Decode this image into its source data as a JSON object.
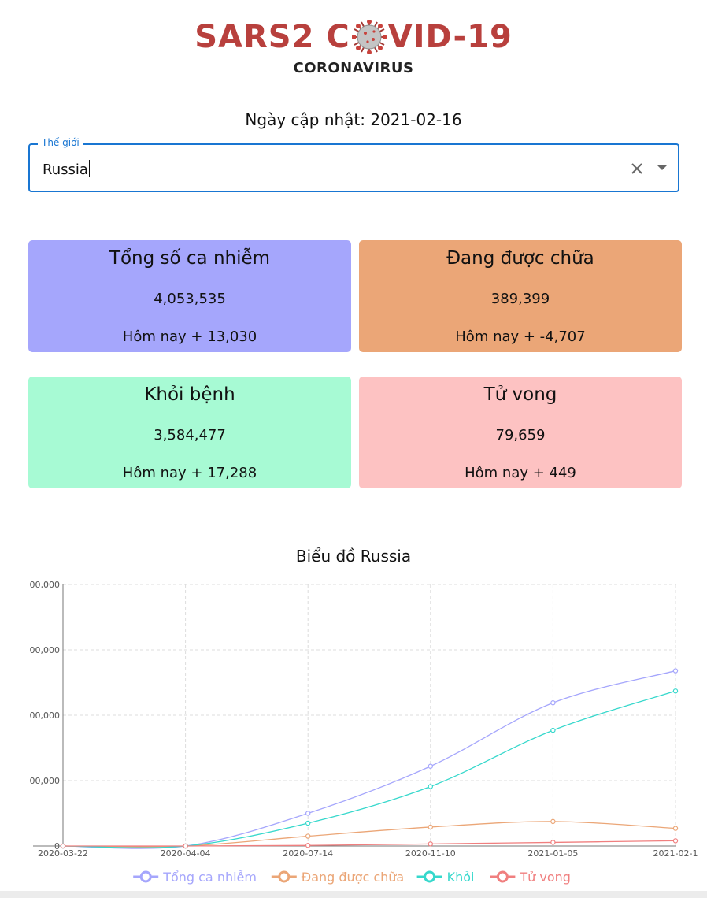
{
  "logo": {
    "title_left": "SARS2 C",
    "title_right": "VID-19",
    "subtitle": "CORONAVIRUS"
  },
  "update": {
    "label": "Ngày cập nhật: 2021-02-16"
  },
  "country_select": {
    "legend": "Thế giới",
    "value": "Russia"
  },
  "cards": {
    "total": {
      "title": "Tổng số ca nhiễm",
      "value": "4,053,535",
      "today": "Hôm nay + 13,030",
      "color": "#a5a6fc"
    },
    "active": {
      "title": "Đang được chữa",
      "value": "389,399",
      "today": "Hôm nay + -4,707",
      "color": "#eba677"
    },
    "recovered": {
      "title": "Khỏi bệnh",
      "value": "3,584,477",
      "today": "Hôm nay + 17,288",
      "color": "#a7fad4"
    },
    "deaths": {
      "title": "Tử vong",
      "value": "79,659",
      "today": "Hôm nay + 449",
      "color": "#fdc2c2"
    }
  },
  "chart_title": "Biểu đồ Russia",
  "chart_data": {
    "type": "line",
    "categories": [
      "2020-03-22",
      "2020-04-04",
      "2020-07-14",
      "2020-11-10",
      "2021-01-05",
      "2021-02-1"
    ],
    "y_ticks": [
      "0",
      "00,000",
      "00,000",
      "00,000",
      "00,000"
    ],
    "ylim": [
      0,
      4000000
    ],
    "grid": true,
    "legend_position": "bottom",
    "series": [
      {
        "name": "Tổng ca nhiễm",
        "color": "#a5a6fc",
        "values": [
          0,
          0,
          500000,
          1220000,
          2190000,
          2680000
        ]
      },
      {
        "name": "Đang được chữa",
        "color": "#eba677",
        "values": [
          0,
          0,
          150000,
          290000,
          375000,
          270000
        ]
      },
      {
        "name": "Khỏi",
        "color": "#36d8cc",
        "values": [
          0,
          0,
          350000,
          910000,
          1770000,
          2370000
        ]
      },
      {
        "name": "Tử vong",
        "color": "#f07f7f",
        "values": [
          0,
          0,
          9000,
          32000,
          55000,
          79659
        ]
      }
    ]
  }
}
